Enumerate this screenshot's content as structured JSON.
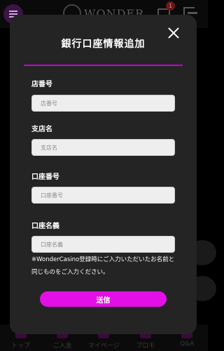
{
  "header": {
    "logo_text": "WONDER",
    "mail_badge_count": "1",
    "icons": [
      "menu-icon",
      "mail-icon",
      "logout-icon"
    ]
  },
  "bottom_nav": [
    {
      "label": "トップ",
      "icon": "home-icon"
    },
    {
      "label": "ご入金",
      "icon": "deposit-icon"
    },
    {
      "label": "マイページ",
      "icon": "user-icon"
    },
    {
      "label": "プロモ",
      "icon": "promo-icon"
    },
    {
      "label": "Q&A",
      "icon": "qa-icon"
    }
  ],
  "modal": {
    "title": "銀行口座情報追加",
    "fields": [
      {
        "label": "店番号",
        "placeholder": "店番号",
        "value": ""
      },
      {
        "label": "支店名",
        "placeholder": "支店名",
        "value": ""
      },
      {
        "label": "口座番号",
        "placeholder": "口座番号",
        "value": ""
      },
      {
        "label": "口座名義",
        "placeholder": "口座名義",
        "value": ""
      }
    ],
    "notice": "※WonderCasino登録時にご入力いただいたお名前と同じものをご入力ください。",
    "submit_label": "送信"
  },
  "colors": {
    "accent": "#e30fe6",
    "rule": "#c800d2",
    "modal_bg": "#242424",
    "backdrop": "#000000"
  }
}
